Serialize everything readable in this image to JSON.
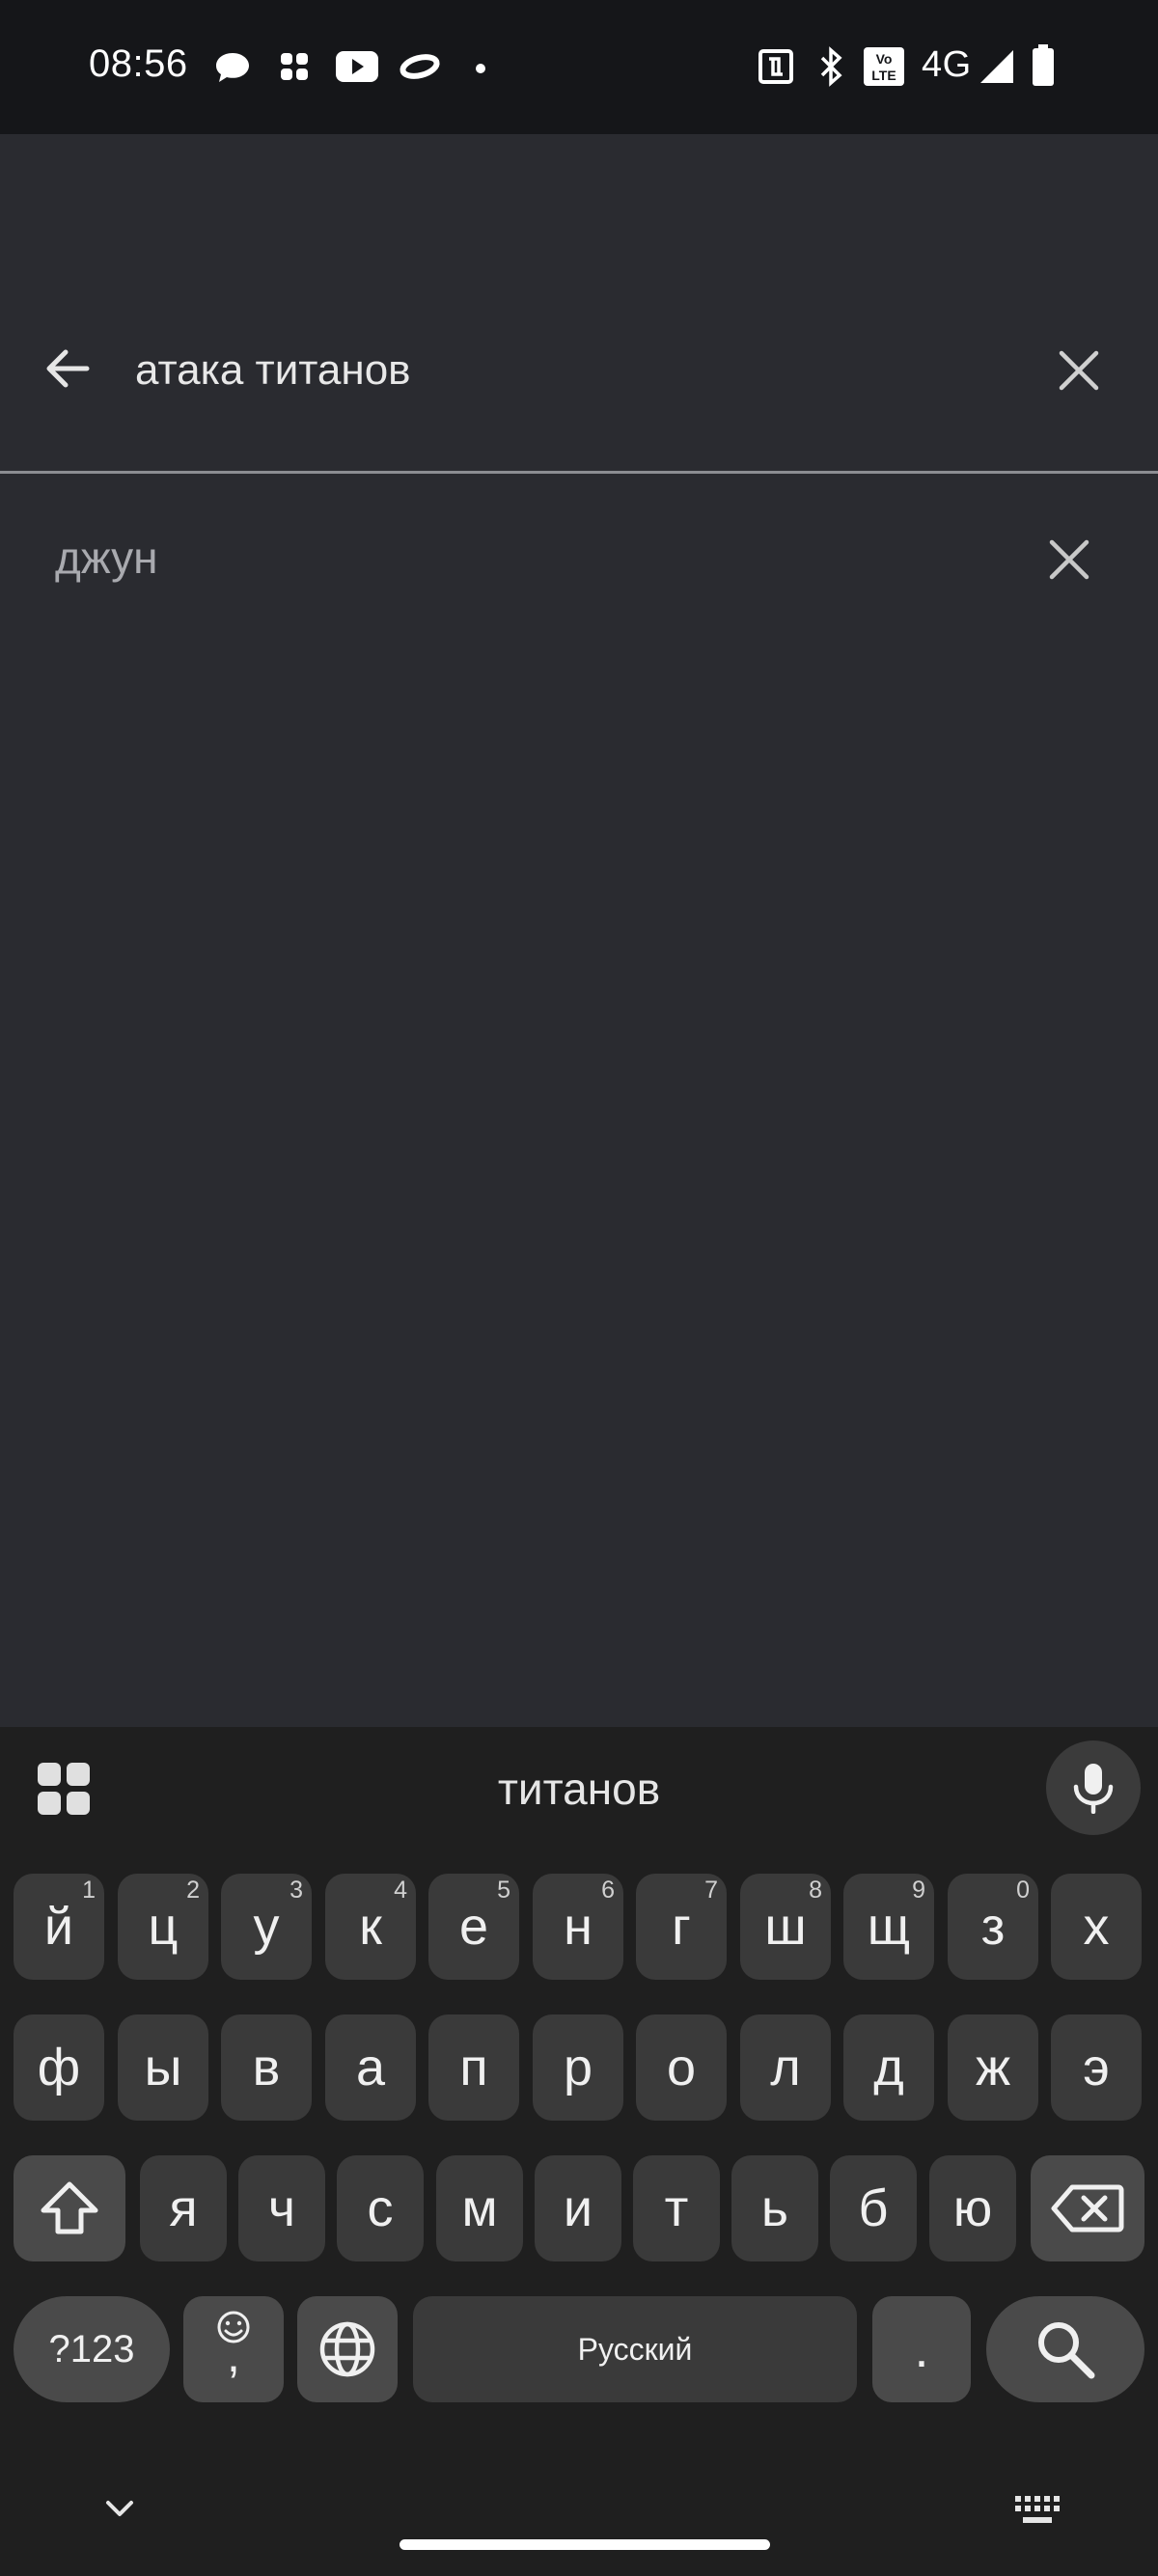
{
  "status_bar": {
    "time": "08:56",
    "network": "4G",
    "volte": "Vo\nLTE",
    "icons_left": [
      "chat-icon",
      "slack-icon",
      "youtube-icon",
      "halo-icon",
      "dot-icon"
    ],
    "icons_right": [
      "nfc-icon",
      "bluetooth-icon",
      "volte-icon",
      "signal-icon",
      "battery-icon"
    ]
  },
  "search": {
    "query": "атака титанов",
    "back_icon": "arrow-back-icon",
    "clear_icon": "close-icon"
  },
  "history": {
    "items": [
      {
        "text": "джун",
        "remove_icon": "close-icon"
      }
    ]
  },
  "keyboard": {
    "suggestion": "титанов",
    "row1": [
      {
        "label": "й",
        "hint": "1"
      },
      {
        "label": "ц",
        "hint": "2"
      },
      {
        "label": "у",
        "hint": "3"
      },
      {
        "label": "к",
        "hint": "4"
      },
      {
        "label": "е",
        "hint": "5"
      },
      {
        "label": "н",
        "hint": "6"
      },
      {
        "label": "г",
        "hint": "7"
      },
      {
        "label": "ш",
        "hint": "8"
      },
      {
        "label": "щ",
        "hint": "9"
      },
      {
        "label": "з",
        "hint": "0"
      },
      {
        "label": "х",
        "hint": ""
      }
    ],
    "row2": [
      "ф",
      "ы",
      "в",
      "а",
      "п",
      "р",
      "о",
      "л",
      "д",
      "ж",
      "э"
    ],
    "row3": [
      "я",
      "ч",
      "с",
      "м",
      "и",
      "т",
      "ь",
      "б",
      "ю"
    ],
    "symbols_label": "?123",
    "comma_label": ",",
    "space_label": "Русский",
    "period_label": ".",
    "colors": {
      "key": "#3a3a3a",
      "func_key": "#4a4a4a",
      "background": "#1f1f1f"
    }
  }
}
